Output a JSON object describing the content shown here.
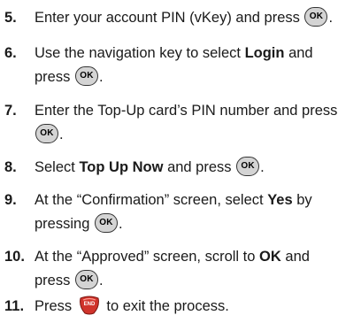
{
  "key_ok": "OK",
  "key_end": "END",
  "steps": [
    {
      "num": "5.",
      "a": "Enter your account PIN (vKey) and press",
      "c": "."
    },
    {
      "num": "6.",
      "a": "Use the navigation key to select",
      "b": "Login",
      "c": "and",
      "d": "press",
      "e": "."
    },
    {
      "num": "7.",
      "a": "Enter the Top-Up card’s PIN number and press",
      "e": "."
    },
    {
      "num": "8.",
      "a": "Select",
      "b": "Top Up Now",
      "c": "and press",
      "e": "."
    },
    {
      "num": "9.",
      "a": "At the “Confirmation” screen, select",
      "b": "Yes",
      "c": "by",
      "d": "pressing",
      "e": "."
    },
    {
      "num": "10.",
      "a": "At the “Approved” screen, scroll to",
      "b": "OK",
      "c": "and",
      "d": "press",
      "e": "."
    },
    {
      "num": "11.",
      "a": "Press",
      "c": "to exit the process."
    }
  ]
}
